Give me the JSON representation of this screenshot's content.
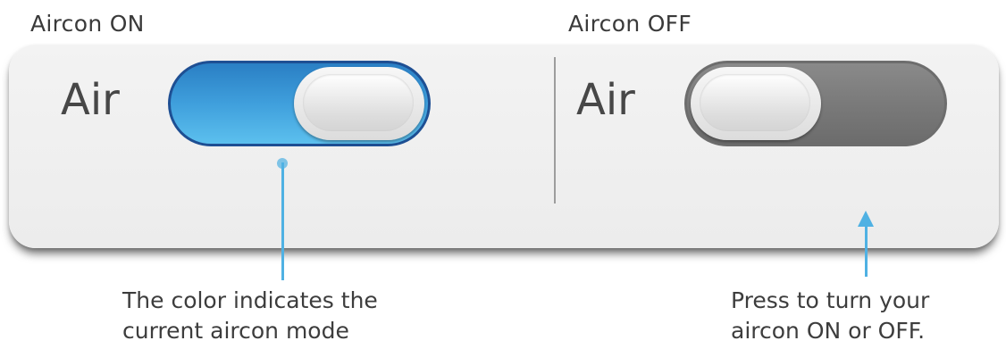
{
  "headings": {
    "on": "Aircon ON",
    "off": "Aircon OFF"
  },
  "switches": {
    "on": {
      "label": "Air",
      "state": "on",
      "color": "#3f9fdc"
    },
    "off": {
      "label": "Air",
      "state": "off",
      "color": "#7a7a7a"
    }
  },
  "callouts": {
    "color_mode": {
      "line1": "The color indicates the",
      "line2": "current aircon mode"
    },
    "press": {
      "line1": "Press to turn your",
      "line2": "aircon ON or OFF."
    },
    "accent_color": "#4fb1e3"
  }
}
